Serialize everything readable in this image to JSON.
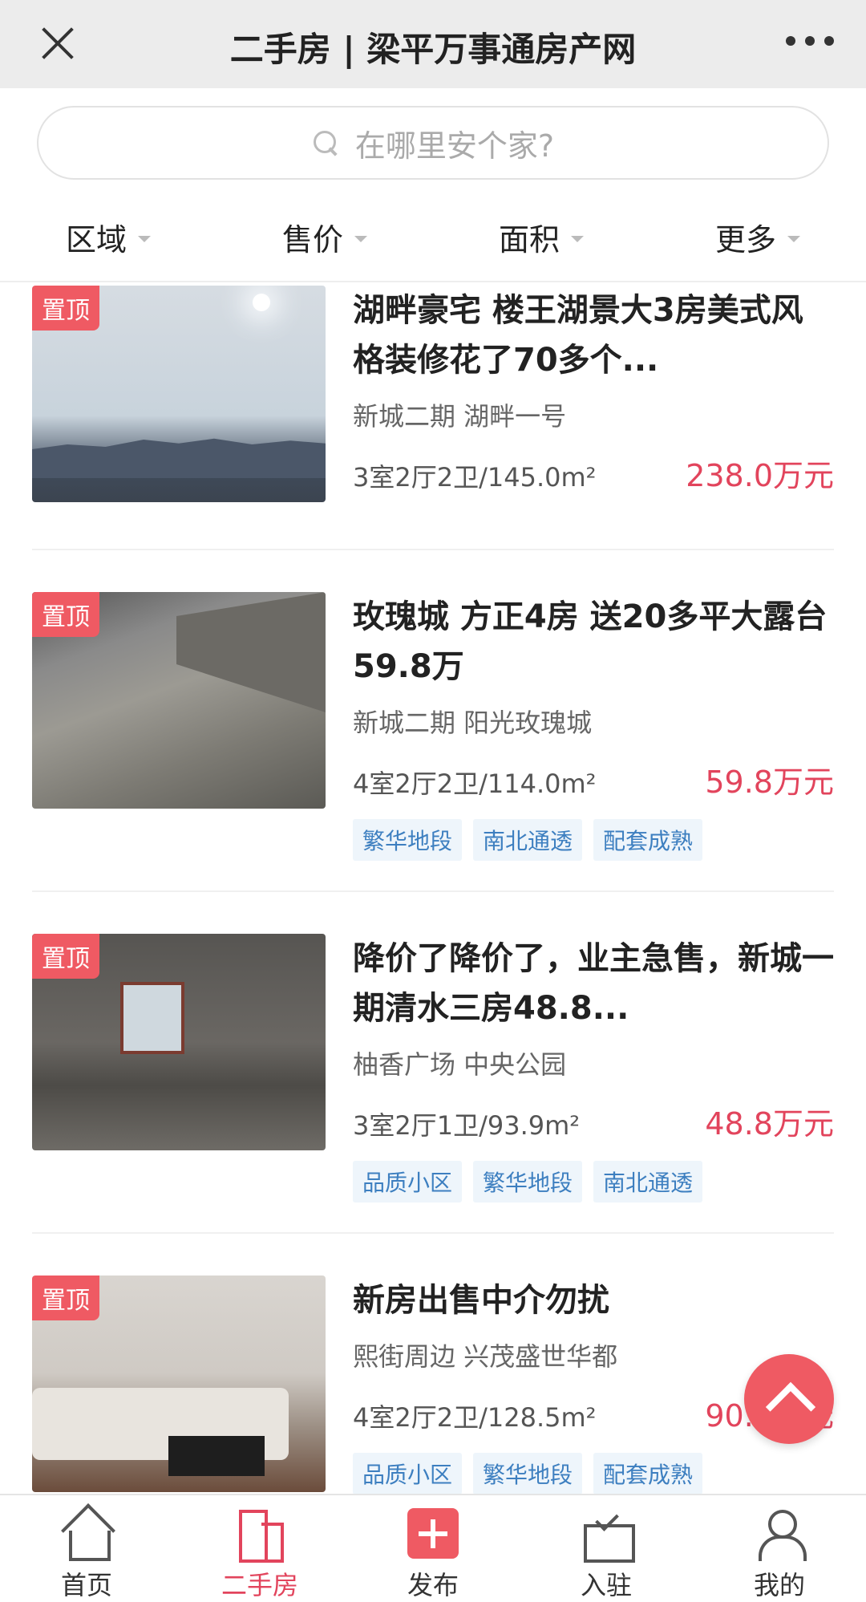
{
  "header": {
    "title": "二手房 | 梁平万事通房产网"
  },
  "search": {
    "placeholder": "在哪里安个家?"
  },
  "filters": [
    "区域",
    "售价",
    "面积",
    "更多"
  ],
  "pin_label": "置顶",
  "listings": [
    {
      "title": "湖畔豪宅 楼王湖景大3房美式风格装修花了70多个...",
      "location": "新城二期 湖畔一号",
      "spec": "3室2厅2卫/145.0m²",
      "price": "238.0万元",
      "tags": []
    },
    {
      "title": "玫瑰城 方正4房 送20多平大露台59.8万",
      "location": "新城二期 阳光玫瑰城",
      "spec": "4室2厅2卫/114.0m²",
      "price": "59.8万元",
      "tags": [
        "繁华地段",
        "南北通透",
        "配套成熟"
      ]
    },
    {
      "title": "降价了降价了，业主急售，新城一期清水三房48.8...",
      "location": "柚香广场 中央公园",
      "spec": "3室2厅1卫/93.9m²",
      "price": "48.8万元",
      "tags": [
        "品质小区",
        "繁华地段",
        "南北通透"
      ]
    },
    {
      "title": "新房出售中介勿扰",
      "location": "熙街周边 兴茂盛世华都",
      "spec": "4室2厅2卫/128.5m²",
      "price": "90.0万元",
      "tags": [
        "品质小区",
        "繁华地段",
        "配套成熟"
      ]
    }
  ],
  "tabbar": {
    "items": [
      {
        "label": "首页",
        "icon": "home-icon"
      },
      {
        "label": "二手房",
        "icon": "building-icon"
      },
      {
        "label": "发布",
        "icon": "plus-icon"
      },
      {
        "label": "入驻",
        "icon": "inbox-icon"
      },
      {
        "label": "我的",
        "icon": "user-icon"
      }
    ],
    "active": "二手房"
  },
  "colors": {
    "accent": "#ef5a63",
    "price": "#e2445c",
    "tag_text": "#3d7fc0",
    "tag_bg": "#eef5fb"
  }
}
